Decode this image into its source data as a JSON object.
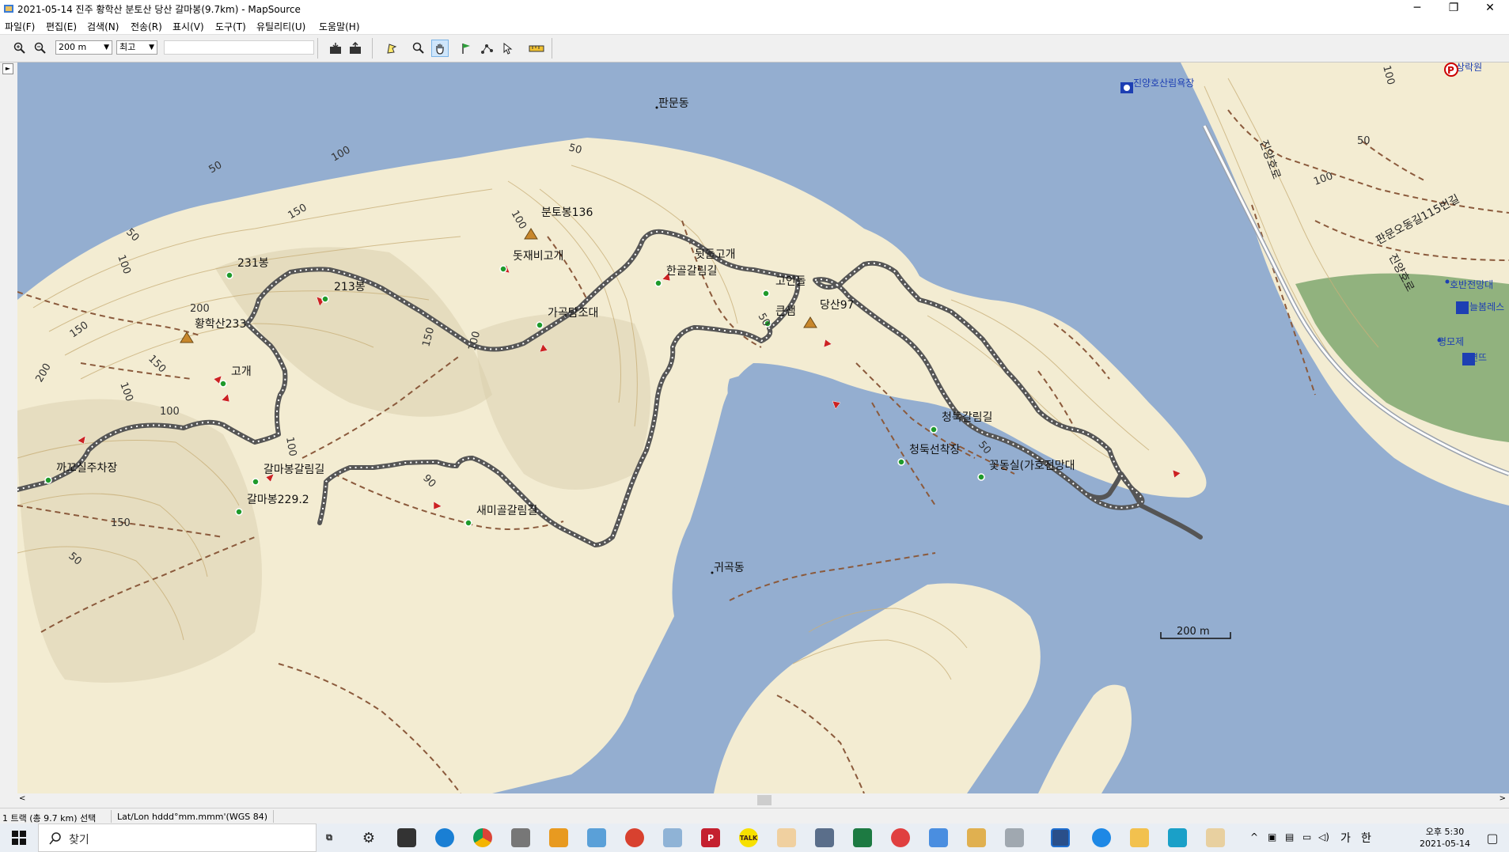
{
  "window": {
    "title": "2021-05-14 진주 황학산 분토산 당산 갈마봉(9.7km) - MapSource",
    "minimize": "─",
    "restore": "❐",
    "close": "✕"
  },
  "menu": [
    "파일(F)",
    "편집(E)",
    "검색(N)",
    "전송(R)",
    "표시(V)",
    "도구(T)",
    "유틸리티(U)",
    "도움말(H)"
  ],
  "toolbar": {
    "zoom_scale": "200 m",
    "detail": "최고"
  },
  "map": {
    "places": [
      {
        "name": "판문동"
      },
      {
        "name": "귀곡동"
      },
      {
        "name": "진양호산림욕장"
      },
      {
        "name": "판문오동길115번길"
      },
      {
        "name": "진양호로"
      },
      {
        "name": "호반전망대"
      },
      {
        "name": "늘봄레스"
      },
      {
        "name": "명모제"
      },
      {
        "name": "연뜨"
      },
      {
        "name": "상락원"
      }
    ],
    "waypoints": [
      {
        "name": "분토봉136",
        "type": "summit"
      },
      {
        "name": "돗재비고개",
        "type": "point"
      },
      {
        "name": "뒷들고개",
        "type": "point"
      },
      {
        "name": "한골갈림길",
        "type": "point"
      },
      {
        "name": "고인돌",
        "type": "point"
      },
      {
        "name": "당산97",
        "type": "summit"
      },
      {
        "name": "큰샘",
        "type": "point"
      },
      {
        "name": "231봉",
        "type": "point"
      },
      {
        "name": "213봉",
        "type": "point"
      },
      {
        "name": "황학산233",
        "type": "summit"
      },
      {
        "name": "고개",
        "type": "point"
      },
      {
        "name": "가곡탐조대",
        "type": "point"
      },
      {
        "name": "청둑갈림길",
        "type": "point"
      },
      {
        "name": "청둑선착장",
        "type": "point"
      },
      {
        "name": "꽃동실(가호전망대",
        "type": "point"
      },
      {
        "name": "갈마봉갈림길",
        "type": "point"
      },
      {
        "name": "갈마봉229.2",
        "type": "point"
      },
      {
        "name": "새미골갈림길",
        "type": "point"
      },
      {
        "name": "까꼬실주차장",
        "type": "point"
      }
    ],
    "contour_labels": [
      "50",
      "100",
      "150",
      "200",
      "50",
      "100",
      "150",
      "100",
      "50",
      "100",
      "150",
      "100",
      "150",
      "200",
      "100",
      "150",
      "50",
      "90",
      "100",
      "50",
      "50",
      "100",
      "50",
      "100"
    ],
    "scale_label": "200 m",
    "colors": {
      "water": "#94aed0",
      "land": "#f3ecd2",
      "forest": "#7fa870",
      "track": "#5a5a5a",
      "trail": "#8b5a3c"
    }
  },
  "status": {
    "selection": "1 트랙 (총 9.7 km) 선택",
    "coords": "Lat/Lon hddd°mm.mmm'(WGS 84)"
  },
  "taskbar": {
    "search_placeholder": "찾기",
    "ime": "가",
    "lang": "한",
    "time": "오후 5:30",
    "date": "2021-05-14"
  }
}
